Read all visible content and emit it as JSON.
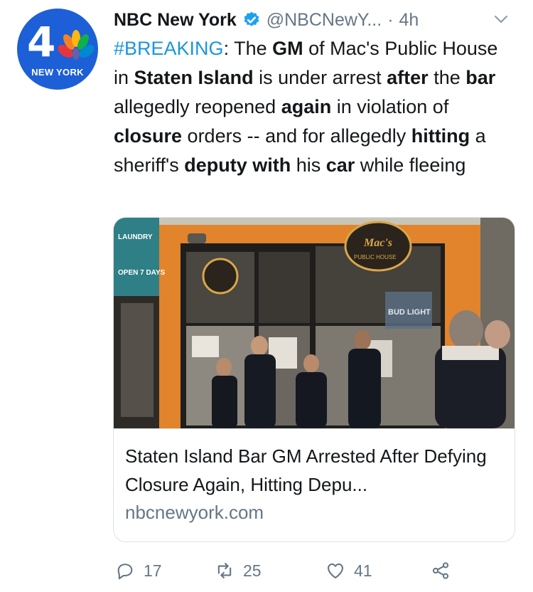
{
  "account": {
    "name": "NBC New York",
    "handle": "@NBCNewY...",
    "separator": "·",
    "time": "4h",
    "avatar_badge": "4",
    "avatar_text": "NEW YORK"
  },
  "tweet": {
    "hashtag": "#BREAKING",
    "segments": [
      {
        "t": ": The ",
        "b": false
      },
      {
        "t": "GM",
        "b": true
      },
      {
        "t": " of Mac's Public House in ",
        "b": false
      },
      {
        "t": "Staten Island",
        "b": true
      },
      {
        "t": " is under arrest ",
        "b": false
      },
      {
        "t": "after",
        "b": true
      },
      {
        "t": " the ",
        "b": false
      },
      {
        "t": "bar",
        "b": true
      },
      {
        "t": " allegedly reopened ",
        "b": false
      },
      {
        "t": "again",
        "b": true
      },
      {
        "t": " in violation of ",
        "b": false
      },
      {
        "t": "closure",
        "b": true
      },
      {
        "t": " orders -- and for allegedly ",
        "b": false
      },
      {
        "t": "hitting",
        "b": true
      },
      {
        "t": " a sheriff's ",
        "b": false
      },
      {
        "t": "deputy with",
        "b": true
      },
      {
        "t": " his ",
        "b": false
      },
      {
        "t": "car",
        "b": true
      },
      {
        "t": " while fleeing",
        "b": false
      }
    ]
  },
  "card": {
    "title": "Staten Island Bar GM Arrested After Defying Closure Again, Hitting Depu...",
    "domain": "nbcnewyork.com",
    "image_signs": {
      "laundry": "LAUNDRY",
      "open_days": "OPEN 7 DAYS",
      "macs": "Mac's",
      "public_house": "PUBLIC HOUSE",
      "bud_light": "BUD LIGHT"
    }
  },
  "actions": {
    "replies": "17",
    "retweets": "25",
    "likes": "41"
  },
  "colors": {
    "link": "#1b95e0",
    "muted": "#657786",
    "brand_blue": "#1d5fd6",
    "verified": "#1da1f2"
  }
}
